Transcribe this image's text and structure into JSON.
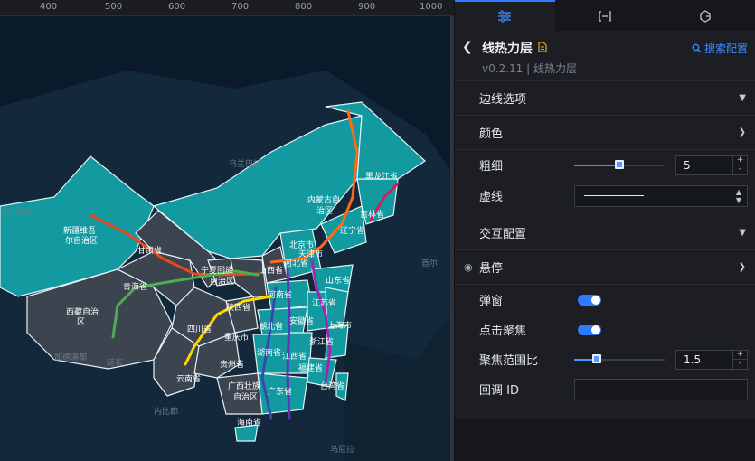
{
  "ruler": {
    "ticks": [
      "400",
      "500",
      "600",
      "700",
      "800",
      "900",
      "1000"
    ]
  },
  "map": {
    "province_labels": [
      "新疆维吾\n尔自治区",
      "西藏自治\n区",
      "青海省",
      "甘肃省",
      "宁夏回族\n自治区",
      "四川省",
      "云南省",
      "贵州省",
      "重庆市",
      "陕西省",
      "山西省",
      "河北省",
      "北京市",
      "天津市",
      "内蒙古自\n治区",
      "辽宁省",
      "吉林省",
      "黑龙江省",
      "山东省",
      "河南省",
      "湖北省",
      "湖南省",
      "江西省",
      "安徽省",
      "江苏省",
      "上海市",
      "浙江省",
      "福建省",
      "台湾省",
      "广东省",
      "广西壮族\n自治区",
      "海南省"
    ],
    "outer_labels": [
      "乌兰巴托",
      "阿斯塔纳",
      "比什凯克",
      "加德满都",
      "廷布",
      "内比都",
      "仰光",
      "首尔",
      "马尼拉",
      "河内"
    ],
    "route_colors": [
      "#e8491d",
      "#ff6a13",
      "#4caf50",
      "#ffd600",
      "#9c27b0",
      "#5e35b1",
      "#3949ab",
      "#d81b60"
    ]
  },
  "tabs": [
    {
      "name": "style-tab",
      "icon": "sliders-icon"
    },
    {
      "name": "data-tab",
      "icon": "bracket-icon"
    },
    {
      "name": "interaction-tab",
      "icon": "refresh-icon"
    }
  ],
  "header": {
    "title": "线热力层",
    "version": "v0.2.11 | 线热力层",
    "search_label": "搜索配置"
  },
  "sections": {
    "edge_options": "边线选项",
    "color": "颜色",
    "thickness_label": "粗细",
    "thickness_value": "5",
    "thickness_fraction": 0.5,
    "dash_label": "虚线",
    "interaction": "交互配置",
    "hover": "悬停",
    "popup_label": "弹窗",
    "popup_on": true,
    "click_focus_label": "点击聚焦",
    "click_focus_on": true,
    "focus_range_label": "聚焦范围比",
    "focus_range_value": "1.5",
    "focus_range_fraction": 0.25,
    "callback_label": "回调 ID",
    "callback_value": ""
  },
  "colors": {
    "accent": "#2e7bff",
    "panel_bg": "#1c1e24",
    "map_bg": "#0b1a2a"
  }
}
